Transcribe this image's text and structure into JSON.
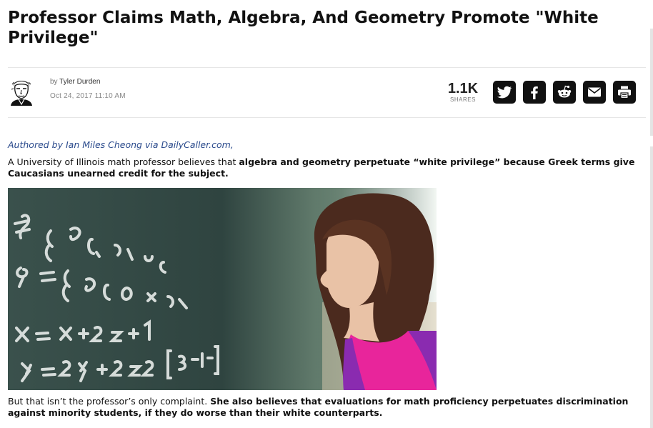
{
  "article": {
    "title": "Professor Claims Math, Algebra, And Geometry Promote \"White Privilege\"",
    "byline_prefix": "by",
    "author": "Tyler Durden",
    "date": "Oct 24, 2017 11:10 AM",
    "shares_count": "1.1K",
    "shares_label": "SHARES",
    "attribution": "Authored by Ian Miles Cheong via DailyCaller.com,",
    "p1_plain": "A University of Illinois math professor believes that ",
    "p1_bold": "algebra and geometry perpetuate “white privilege” because Greek terms give Caucasians unearned credit for the subject.",
    "p2_plain": "But that isn’t the professor’s only complaint. ",
    "p2_bold": "She also believes that evaluations for math proficiency perpetuates discrimination against minority students, if they do worse than their white counterparts.",
    "image_text": {
      "line1": "? = z ↔",
      "line2": "P = { P [ 1",
      "line3": "q = { Q [ 0 . 4 5",
      "line4": "X = X + 2 z + 1",
      "line5": "y = 2 y + 2 z + 2   [ 3 - 1 - 2 ]"
    }
  },
  "share_buttons": [
    {
      "name": "twitter-icon"
    },
    {
      "name": "facebook-icon"
    },
    {
      "name": "reddit-icon"
    },
    {
      "name": "email-icon"
    },
    {
      "name": "print-icon"
    }
  ],
  "colors": {
    "attribution_link": "#2a4a8c",
    "share_button_bg": "#111111",
    "shirt": "#e8259b",
    "vest": "#8a2bb0",
    "chalkboard": "#2f4440"
  }
}
